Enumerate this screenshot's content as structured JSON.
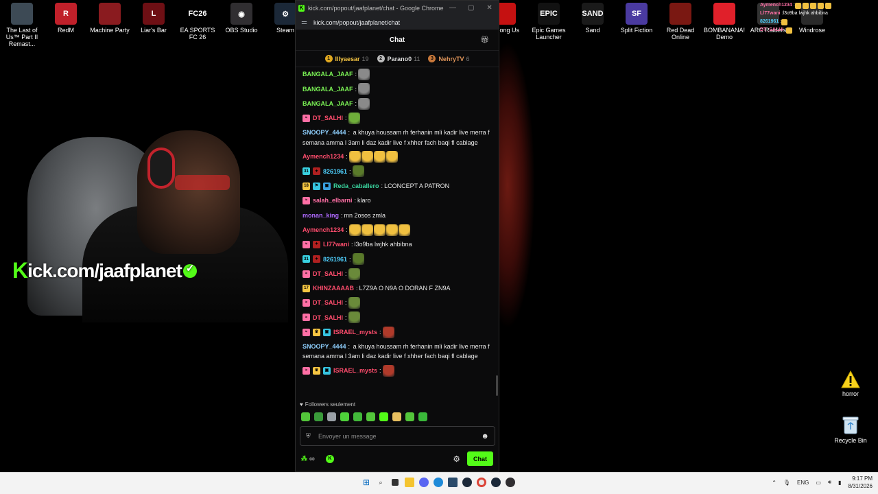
{
  "desktop_icons": [
    {
      "label": "The Last of Us™ Part II Remast...",
      "icon": "tlou-icon",
      "color": "#3d4a55",
      "glyph": ""
    },
    {
      "label": "RedM",
      "icon": "redm-icon",
      "color": "#c0202a",
      "glyph": "R"
    },
    {
      "label": "Machine Party",
      "icon": "machine-party-icon",
      "color": "#8a1b1f",
      "glyph": ""
    },
    {
      "label": "Liar's Bar",
      "icon": "liars-bar-icon",
      "color": "#6e0f14",
      "glyph": "L"
    },
    {
      "label": "EA SPORTS FC 26",
      "icon": "fc26-icon",
      "color": "#000000",
      "glyph": "FC26"
    },
    {
      "label": "OBS Studio",
      "icon": "obs-icon",
      "color": "#302e31",
      "glyph": "◉"
    },
    {
      "label": "Steam",
      "icon": "steam-icon",
      "color": "#1b2838",
      "glyph": "⚙"
    },
    {
      "label": "Among Us",
      "icon": "among-us-icon",
      "color": "#c51111",
      "glyph": ""
    },
    {
      "label": "Epic Games Launcher",
      "icon": "epic-icon",
      "color": "#121212",
      "glyph": "EPIC"
    },
    {
      "label": "Sand",
      "icon": "sand-icon",
      "color": "#1a1a1a",
      "glyph": "SAND"
    },
    {
      "label": "Split Fiction",
      "icon": "split-fiction-icon",
      "color": "#4a3aa0",
      "glyph": "SF"
    },
    {
      "label": "Red Dead Online",
      "icon": "rdo-icon",
      "color": "#7a1812",
      "glyph": ""
    },
    {
      "label": "BOMBANANA! Demo",
      "icon": "bombanana-icon",
      "color": "#e0202a",
      "glyph": ""
    },
    {
      "label": "ARC Raiders",
      "icon": "arc-raiders-icon",
      "color": "#333333",
      "glyph": ""
    },
    {
      "label": "Windrose",
      "icon": "windrose-icon",
      "color": "#2a2a2a",
      "glyph": ""
    }
  ],
  "right_icons": [
    {
      "label": "horror",
      "icon": "warning-icon"
    },
    {
      "label": "Recycle Bin",
      "icon": "recycle-bin-icon"
    }
  ],
  "overlay": {
    "k": "K",
    "text": "ick.com/jaafplanet"
  },
  "chrome": {
    "title": "kick.com/popout/jaafplanet/chat - Google Chrome",
    "url": "kick.com/popout/jaafplanet/chat",
    "min": "—",
    "max": "▢",
    "close": "✕"
  },
  "chat": {
    "header": "Chat",
    "leaders": [
      {
        "rank": "1",
        "name": "Illyaesar",
        "count": "19",
        "color": "#f5c542",
        "medal": "#e0a820"
      },
      {
        "rank": "2",
        "name": "Parano0",
        "count": "11",
        "color": "#dddddd",
        "medal": "#bcbcbc"
      },
      {
        "rank": "3",
        "name": "NehryTV",
        "count": "6",
        "color": "#e0955a",
        "medal": "#c8783a"
      }
    ],
    "messages": [
      {
        "user": "BANGALA_JAAF",
        "color": "#7cf556",
        "badges": [],
        "text": "",
        "emotes": 1,
        "emote_color": "#8a8a8a"
      },
      {
        "user": "BANGALA_JAAF",
        "color": "#7cf556",
        "badges": [],
        "text": "",
        "emotes": 1,
        "emote_color": "#8a8a8a"
      },
      {
        "user": "BANGALA_JAAF",
        "color": "#7cf556",
        "badges": [],
        "text": "",
        "emotes": 1,
        "emote_color": "#8a8a8a"
      },
      {
        "user": "DT_SALHI",
        "color": "#ff4d6d",
        "badges": [
          {
            "c": "#ff6fa5",
            "t": "≈"
          }
        ],
        "text": "",
        "emotes": 1,
        "emote_color": "#6fae3a"
      },
      {
        "user": "SNOOPY_4444",
        "color": "#8fd0ff",
        "badges": [],
        "text": "a khuya houssam rh ferhanin mli kadir live merra f semana amma l 3am li daz kadir live f xhher fach baqi fl cablage",
        "emotes": 0,
        "multi": true
      },
      {
        "user": "Aymench1234",
        "color": "#ff4d6d",
        "badges": [],
        "text": "",
        "emotes": 4,
        "emote_color": "#f0c040"
      },
      {
        "user": "8261961",
        "color": "#4fd1ff",
        "badges": [
          {
            "c": "#39d0e0",
            "t": "31"
          },
          {
            "c": "#b02020",
            "t": "✦"
          }
        ],
        "text": "",
        "emotes": 1,
        "emote_color": "#5a7a2a"
      },
      {
        "user": "Reda_caballero",
        "color": "#3ad6a0",
        "badges": [
          {
            "c": "#f5c542",
            "t": "18"
          },
          {
            "c": "#36c4e0",
            "t": "⚑"
          },
          {
            "c": "#3aa0e0",
            "t": "▣"
          }
        ],
        "text": "LCONCEPT A PATRON",
        "emotes": 0
      },
      {
        "user": "salah_elbarni",
        "color": "#ff6fa5",
        "badges": [
          {
            "c": "#ff6fa5",
            "t": "≈"
          }
        ],
        "text": "klaro",
        "emotes": 0
      },
      {
        "user": "monan_king",
        "color": "#b06aff",
        "badges": [],
        "text": "mn 2osos zmla",
        "emotes": 0
      },
      {
        "user": "Aymench1234",
        "color": "#ff4d6d",
        "badges": [],
        "text": "",
        "emotes": 5,
        "emote_color": "#f0c040"
      },
      {
        "user": "Ll77wani",
        "color": "#ff4d6d",
        "badges": [
          {
            "c": "#ff6fa5",
            "t": "≈"
          },
          {
            "c": "#b02020",
            "t": "✦"
          }
        ],
        "text": "l3o9ba lwjhk ahbibna",
        "emotes": 0
      },
      {
        "user": "8261961",
        "color": "#4fd1ff",
        "badges": [
          {
            "c": "#39d0e0",
            "t": "31"
          },
          {
            "c": "#b02020",
            "t": "✦"
          }
        ],
        "text": "",
        "emotes": 1,
        "emote_color": "#5a7a2a"
      },
      {
        "user": "DT_SALHI",
        "color": "#ff4d6d",
        "badges": [
          {
            "c": "#ff6fa5",
            "t": "≈"
          }
        ],
        "text": "",
        "emotes": 1,
        "emote_color": "#6a8a3a"
      },
      {
        "user": "KHINZAAAAB",
        "color": "#ff4d6d",
        "badges": [
          {
            "c": "#f5c542",
            "t": "17"
          }
        ],
        "text": "L7Z9A O N9A O DORAN F ZN9A",
        "emotes": 0
      },
      {
        "user": "DT_SALHI",
        "color": "#ff4d6d",
        "badges": [
          {
            "c": "#ff6fa5",
            "t": "≈"
          }
        ],
        "text": "",
        "emotes": 1,
        "emote_color": "#6a8a3a"
      },
      {
        "user": "DT_SALHI",
        "color": "#ff4d6d",
        "badges": [
          {
            "c": "#ff6fa5",
            "t": "≈"
          }
        ],
        "text": "",
        "emotes": 1,
        "emote_color": "#6a8a3a"
      },
      {
        "user": "ISRAEL_mysts",
        "color": "#ff4d6d",
        "badges": [
          {
            "c": "#ff6fa5",
            "t": "≈"
          },
          {
            "c": "#f5c542",
            "t": "♛"
          },
          {
            "c": "#36c4e0",
            "t": "▣"
          }
        ],
        "text": "",
        "emotes": 1,
        "emote_color": "#b03a2a"
      },
      {
        "user": "SNOOPY_4444",
        "color": "#8fd0ff",
        "badges": [],
        "text": "a khuya houssam rh ferhanin mli kadir live merra f semana amma l 3am li daz kadir live f xhher fach baqi fl cablage",
        "emotes": 0,
        "multi": true
      },
      {
        "user": "ISRAEL_mysts",
        "color": "#ff4d6d",
        "badges": [
          {
            "c": "#ff6fa5",
            "t": "≈"
          },
          {
            "c": "#f5c542",
            "t": "♛"
          },
          {
            "c": "#36c4e0",
            "t": "▣"
          }
        ],
        "text": "",
        "emotes": 1,
        "emote_color": "#b03a2a"
      }
    ],
    "followers_label": "Followers seulement",
    "input_placeholder": "Envoyer un message",
    "points_icon": "∞",
    "send_label": "Chat"
  },
  "mini_chat": [
    {
      "user": "Aymench1234",
      "color": "#ff6fa5",
      "text": "",
      "emotes": 5
    },
    {
      "user": "Ll77wani",
      "color": "#ff6fa5",
      "text": "l3o9ba lwjhk ahbibna",
      "emotes": 0
    },
    {
      "user": "8261961",
      "color": "#4fd1ff",
      "text": "",
      "emotes": 1
    },
    {
      "user": "DT_SALHI",
      "color": "#ff6fa5",
      "text": "",
      "emotes": 1
    }
  ],
  "taskbar": {
    "lang": "ENG",
    "time": "9:17 PM",
    "date": "8/31/2026"
  }
}
